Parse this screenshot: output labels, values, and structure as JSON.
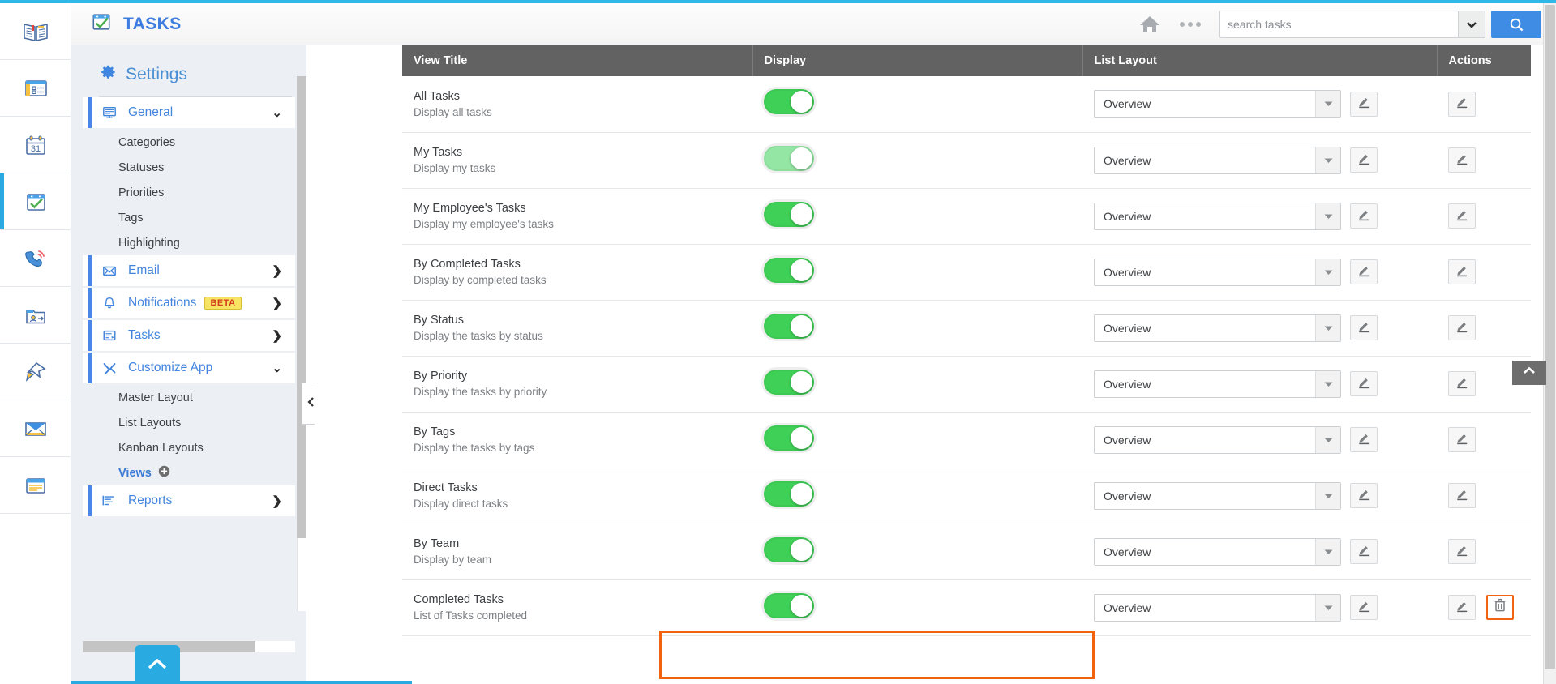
{
  "app": {
    "title": "TASKS",
    "title_icon": "tasks-calendar-check-icon",
    "accent_blue": "#3d7de0",
    "strip_color": "#2fb7e8"
  },
  "rail": {
    "items": [
      {
        "name": "knowledge-book-icon",
        "label": "Knowledge"
      },
      {
        "name": "news-board-icon",
        "label": "News"
      },
      {
        "name": "calendar-31-icon",
        "label": "Calendar"
      },
      {
        "name": "tasks-check-icon",
        "label": "Tasks",
        "active": true
      },
      {
        "name": "phone-call-icon",
        "label": "Calls"
      },
      {
        "name": "contacts-folder-icon",
        "label": "Contacts"
      },
      {
        "name": "pin-icon",
        "label": "Pinned"
      },
      {
        "name": "mail-envelope-icon",
        "label": "Mail"
      },
      {
        "name": "notes-icon",
        "label": "Notes"
      }
    ]
  },
  "header": {
    "home_icon": "home-icon",
    "more_icon": "more-dots-icon",
    "search": {
      "placeholder": "search tasks",
      "value": "",
      "caret_icon": "chevron-down-icon",
      "button_icon": "search-icon"
    }
  },
  "settings": {
    "heading": "Settings",
    "heading_icon": "gear-icon",
    "nav": [
      {
        "type": "group",
        "label": "General",
        "icon": "monitor-icon",
        "chevron": "⌄",
        "expanded": true,
        "children": [
          "Categories",
          "Statuses",
          "Priorities",
          "Tags",
          "Highlighting"
        ]
      },
      {
        "type": "group",
        "label": "Email",
        "icon": "envelope-open-icon",
        "chevron": "❯",
        "expanded": false,
        "children": []
      },
      {
        "type": "group",
        "label": "Notifications",
        "icon": "bell-icon",
        "badge": "BETA",
        "chevron": "❯",
        "expanded": false,
        "children": []
      },
      {
        "type": "group",
        "label": "Tasks",
        "icon": "task-list-icon",
        "chevron": "❯",
        "expanded": false,
        "children": []
      },
      {
        "type": "group",
        "label": "Customize App",
        "icon": "tools-icon",
        "chevron": "⌄",
        "expanded": true,
        "children": [
          "Master Layout",
          "List Layouts",
          "Kanban Layouts"
        ]
      }
    ],
    "views_link": {
      "label": "Views",
      "add_icon": "plus-circle-icon"
    },
    "reports": {
      "label": "Reports",
      "icon": "report-lines-icon",
      "chevron": "❯"
    },
    "collapse_handle_icon": "chevron-left-icon"
  },
  "table": {
    "columns": [
      "View Title",
      "Display",
      "List Layout",
      "Actions"
    ],
    "layout_caret_icon": "caret-down-icon",
    "edit_icon": "pencil-icon",
    "delete_icon": "trash-icon",
    "rows": [
      {
        "title": "All Tasks",
        "desc": "Display all tasks",
        "display_on": true,
        "toggle_state": "on",
        "layout": "Overview",
        "has_delete": false
      },
      {
        "title": "My Tasks",
        "desc": "Display my tasks",
        "display_on": true,
        "toggle_state": "on-light",
        "layout": "Overview",
        "has_delete": false
      },
      {
        "title": "My Employee's Tasks",
        "desc": "Display my employee's tasks",
        "display_on": true,
        "toggle_state": "on",
        "layout": "Overview",
        "has_delete": false
      },
      {
        "title": "By Completed Tasks",
        "desc": "Display by completed tasks",
        "display_on": true,
        "toggle_state": "on",
        "layout": "Overview",
        "has_delete": false
      },
      {
        "title": "By Status",
        "desc": "Display the tasks by status",
        "display_on": true,
        "toggle_state": "on",
        "layout": "Overview",
        "has_delete": false
      },
      {
        "title": "By Priority",
        "desc": "Display the tasks by priority",
        "display_on": true,
        "toggle_state": "on",
        "layout": "Overview",
        "has_delete": false
      },
      {
        "title": "By Tags",
        "desc": "Display the tasks by tags",
        "display_on": true,
        "toggle_state": "on",
        "layout": "Overview",
        "has_delete": false
      },
      {
        "title": "Direct Tasks",
        "desc": "Display direct tasks",
        "display_on": true,
        "toggle_state": "on",
        "layout": "Overview",
        "has_delete": false
      },
      {
        "title": "By Team",
        "desc": "Display by team",
        "display_on": true,
        "toggle_state": "on",
        "layout": "Overview",
        "has_delete": false
      },
      {
        "title": "Completed Tasks",
        "desc": "List of Tasks completed",
        "display_on": true,
        "toggle_state": "on",
        "layout": "Overview",
        "has_delete": true,
        "highlighted": true
      }
    ]
  },
  "misc": {
    "scroll_top_icon": "chevron-up-icon",
    "float_up_icon": "chevron-up-icon",
    "highlight_color": "#f2630f",
    "toggle_on_color": "#3fd157",
    "toggle_light_color": "#93e6a4"
  }
}
